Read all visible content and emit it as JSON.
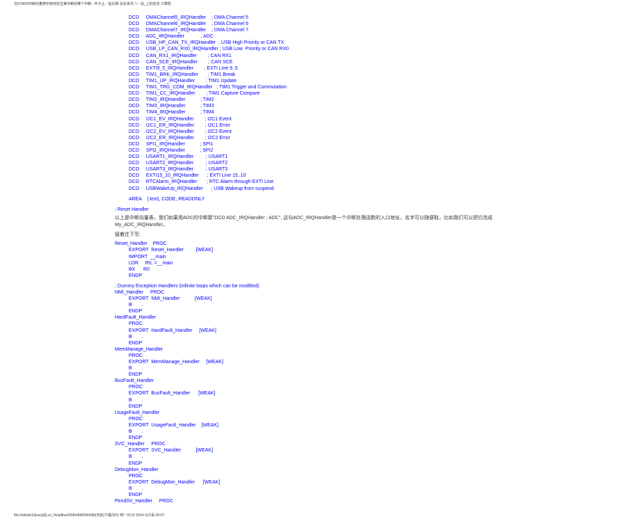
{
  "header": "在STM32中断向量表中如何定位某中断的哪个中断 - 中子止···站长网 站长资讯 / / - 站_上的信息 计算机",
  "footer": "file:///d/edx/Library|站.cn_%/spfiles/3040/498244438|(无标)下载/201/ 统一20.0/ 2014-11/1佑 00:07",
  "dcd_lines": [
    {
      "inst": "DCD",
      "handler": "DMAChannel5_IRQHandler",
      "comment": "; DMA Channel 5"
    },
    {
      "inst": "DCD",
      "handler": "DMAChannel6_IRQHandler",
      "comment": "; DMA Channel 6"
    },
    {
      "inst": "DCD",
      "handler": "DMAChannel7_IRQHandler",
      "comment": "; DMA Channel 7"
    },
    {
      "inst": "DCD",
      "handler": "ADC_IRQHandler",
      "comment": "; ADC"
    },
    {
      "inst": "DCD",
      "handler": "USB_HP_CAN_TX_IRQHandler",
      "comment": "; USB High Priority or CAN TX"
    },
    {
      "inst": "DCD",
      "handler": "USB_LP_CAN_RX0_IRQHandler",
      "comment": "; USB Low  Priority or CAN RX0"
    },
    {
      "inst": "DCD",
      "handler": "CAN_RX1_IRQHandler",
      "comment": "; CAN RX1"
    },
    {
      "inst": "DCD",
      "handler": "CAN_SCE_IRQHandler",
      "comment": "; CAN SCE"
    },
    {
      "inst": "DCD",
      "handler": "EXTI9_5_IRQHandler",
      "comment": "; EXTI Line 9..5"
    },
    {
      "inst": "DCD",
      "handler": "TIM1_BRK_IRQHandler",
      "comment": "; TIM1 Break"
    },
    {
      "inst": "DCD",
      "handler": "TIM1_UP_IRQHandler",
      "comment": "; TIM1 Update"
    },
    {
      "inst": "DCD",
      "handler": "TIM1_TRG_COM_IRQHandler",
      "comment": "; TIM1 Trigger and Commutation"
    },
    {
      "inst": "DCD",
      "handler": "TIM1_CC_IRQHandler",
      "comment": "; TIM1 Capture Compare"
    },
    {
      "inst": "DCD",
      "handler": "TIM2_IRQHandler",
      "comment": "; TIM2"
    },
    {
      "inst": "DCD",
      "handler": "TIM3_IRQHandler",
      "comment": "; TIM3"
    },
    {
      "inst": "DCD",
      "handler": "TIM4_IRQHandler",
      "comment": "; TIM4"
    },
    {
      "inst": "DCD",
      "handler": "I2C1_EV_IRQHandler",
      "comment": "; I2C1 Event"
    },
    {
      "inst": "DCD",
      "handler": "I2C1_ER_IRQHandler",
      "comment": "; I2C1 Error"
    },
    {
      "inst": "DCD",
      "handler": "I2C2_EV_IRQHandler",
      "comment": "; I2C2 Event"
    },
    {
      "inst": "DCD",
      "handler": "I2C2_ER_IRQHandler",
      "comment": "; I2C2 Error"
    },
    {
      "inst": "DCD",
      "handler": "SPI1_IRQHandler",
      "comment": "; SPI1"
    },
    {
      "inst": "DCD",
      "handler": "SPI2_IRQHandler",
      "comment": "; SPI2"
    },
    {
      "inst": "DCD",
      "handler": "USART1_IRQHandler",
      "comment": "; USART1"
    },
    {
      "inst": "DCD",
      "handler": "USART2_IRQHandler",
      "comment": "; USART2"
    },
    {
      "inst": "DCD",
      "handler": "USART3_IRQHandler",
      "comment": "; USART3"
    },
    {
      "inst": "DCD",
      "handler": "EXTI15_10_IRQHandler",
      "comment": "; EXTI Line 15..10"
    },
    {
      "inst": "DCD",
      "handler": "RTCAlarm_IRQHandler",
      "comment": "; RTC Alarm through EXTI Line"
    },
    {
      "inst": "DCD",
      "handler": "USBWakeUp_IRQHandler",
      "comment": "; USB Wakeup from suspend"
    }
  ],
  "area_line": {
    "inst": "AREA",
    "rest": "|.text|, CODE, READONLY"
  },
  "reset_comment": "; Reset Handler",
  "narration_prefix": "以上是中断向量表，我们如果用ADC的中断那\"DCD     ADC_IRQHandler            ; ADC\", 这句ADC_IRQHandler是一个中断处理函数的入口地址，名字可以随便取，比如我们可以把它改成My_ADC_IRQHandler。",
  "narration_next": "接着往下写:",
  "blocks": [
    {
      "name": "Reset_Handler",
      "proc_same": true,
      "export": "Reset_Handler",
      "weak": "[WEAK]",
      "extra": [
        "IMPORT  __main",
        "LDR     R0, =__main",
        "BX      R0"
      ]
    }
  ],
  "dummy_comment": "; Dummy Exception Handlers (infinite loops which can be modified)",
  "handlers2": [
    {
      "name": "NMI_Handler",
      "proc_same": true
    },
    {
      "name": "HardFault_Handler",
      "proc_same": false
    },
    {
      "name": "MemManage_Handler",
      "proc_same": false
    },
    {
      "name": "BusFault_Handler",
      "proc_same": false
    },
    {
      "name": "UsageFault_Handler",
      "proc_same": false
    },
    {
      "name": "SVC_Handler",
      "proc_same": true
    },
    {
      "name": "DebugMon_Handler",
      "proc_same": false
    },
    {
      "name": "PendSV_Handler",
      "proc_same": true,
      "no_body": true
    }
  ],
  "weak": "[WEAK]"
}
